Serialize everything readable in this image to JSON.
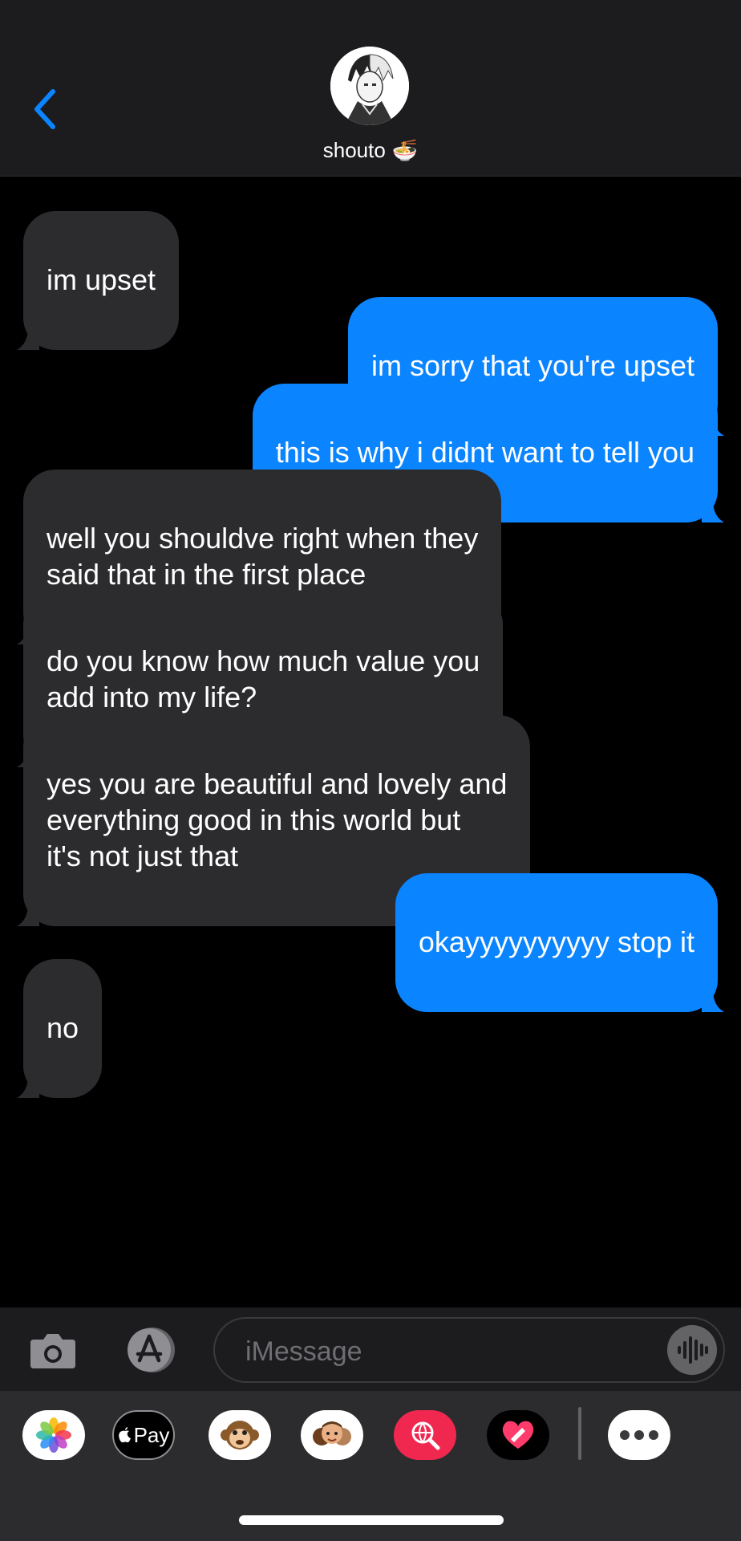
{
  "header": {
    "contact_name": "shouto",
    "contact_emoji": "🍜"
  },
  "messages": [
    {
      "direction": "incoming",
      "text": "im upset"
    },
    {
      "direction": "outgoing",
      "text": "im sorry that you're upset"
    },
    {
      "direction": "outgoing",
      "text": "this is why i didnt want to tell you"
    },
    {
      "direction": "incoming",
      "text": "well you shouldve right when they\nsaid that in the first place"
    },
    {
      "direction": "incoming",
      "text": "do you know how much value you\nadd into my life?"
    },
    {
      "direction": "incoming",
      "text": "yes you are beautiful and lovely and\neverything good in this world but\nit's not just that"
    },
    {
      "direction": "outgoing",
      "text": "okayyyyyyyyyy stop it"
    },
    {
      "direction": "incoming",
      "text": "no"
    }
  ],
  "input": {
    "placeholder": "iMessage"
  },
  "app_drawer": {
    "apple_pay_label": "Pay",
    "apps": [
      "photos-icon",
      "apple-pay-icon",
      "animoji-icon",
      "memoji-icon",
      "image-search-icon",
      "digital-touch-icon",
      "more-icon"
    ]
  },
  "colors": {
    "outgoing_bubble": "#0b84ff",
    "incoming_bubble": "#2c2c2e",
    "accent": "#0a84ff"
  }
}
